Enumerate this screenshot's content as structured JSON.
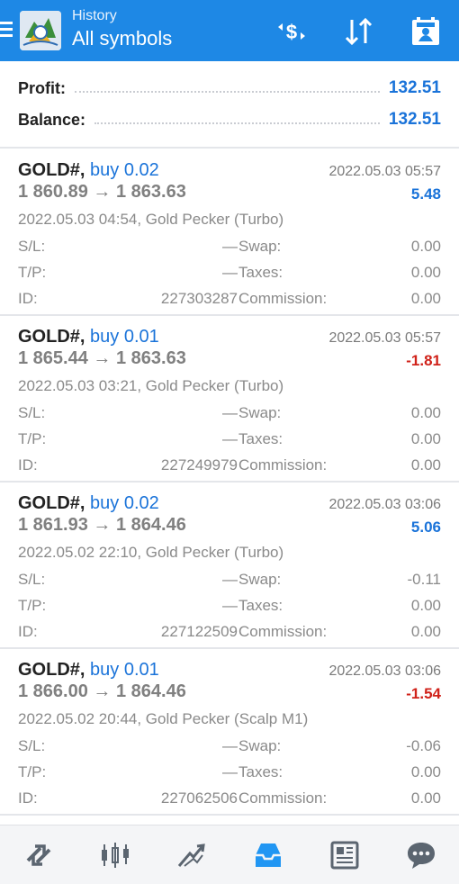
{
  "header": {
    "subtitle": "History",
    "title": "All symbols",
    "accent_color": "#1e88e5",
    "icons": [
      "menu-icon",
      "app-logo-icon",
      "currency-filter-icon",
      "sort-icon",
      "calendar-icon"
    ]
  },
  "summary": {
    "profit_label": "Profit:",
    "profit_value": "132.51",
    "balance_label": "Balance:",
    "balance_value": "132.51"
  },
  "trades": [
    {
      "symbol": "GOLD#,",
      "direction": "buy 0.02",
      "close_time": "2022.05.03 05:57",
      "prices": "1 860.89 → 1 863.63",
      "profit": "5.48",
      "profit_sign": "positive",
      "open_info": "2022.05.03 04:54, Gold Pecker (Turbo)",
      "sl_label": "S/L:",
      "sl_value": "—",
      "swap_label": "Swap:",
      "swap_value": "0.00",
      "tp_label": "T/P:",
      "tp_value": "—",
      "taxes_label": "Taxes:",
      "taxes_value": "0.00",
      "id_label": "ID:",
      "id_value": "227303287",
      "commission_label": "Commission:",
      "commission_value": "0.00"
    },
    {
      "symbol": "GOLD#,",
      "direction": "buy 0.01",
      "close_time": "2022.05.03 05:57",
      "prices": "1 865.44 → 1 863.63",
      "profit": "-1.81",
      "profit_sign": "negative",
      "open_info": "2022.05.03 03:21, Gold Pecker (Turbo)",
      "sl_label": "S/L:",
      "sl_value": "—",
      "swap_label": "Swap:",
      "swap_value": "0.00",
      "tp_label": "T/P:",
      "tp_value": "—",
      "taxes_label": "Taxes:",
      "taxes_value": "0.00",
      "id_label": "ID:",
      "id_value": "227249979",
      "commission_label": "Commission:",
      "commission_value": "0.00"
    },
    {
      "symbol": "GOLD#,",
      "direction": "buy 0.02",
      "close_time": "2022.05.03 03:06",
      "prices": "1 861.93 → 1 864.46",
      "profit": "5.06",
      "profit_sign": "positive",
      "open_info": "2022.05.02 22:10, Gold Pecker (Turbo)",
      "sl_label": "S/L:",
      "sl_value": "—",
      "swap_label": "Swap:",
      "swap_value": "-0.11",
      "tp_label": "T/P:",
      "tp_value": "—",
      "taxes_label": "Taxes:",
      "taxes_value": "0.00",
      "id_label": "ID:",
      "id_value": "227122509",
      "commission_label": "Commission:",
      "commission_value": "0.00"
    },
    {
      "symbol": "GOLD#,",
      "direction": "buy 0.01",
      "close_time": "2022.05.03 03:06",
      "prices": "1 866.00 → 1 864.46",
      "profit": "-1.54",
      "profit_sign": "negative",
      "open_info": "2022.05.02 20:44, Gold Pecker (Scalp M1)",
      "sl_label": "S/L:",
      "sl_value": "—",
      "swap_label": "Swap:",
      "swap_value": "-0.06",
      "tp_label": "T/P:",
      "tp_value": "—",
      "taxes_label": "Taxes:",
      "taxes_value": "0.00",
      "id_label": "ID:",
      "id_value": "227062506",
      "commission_label": "Commission:",
      "commission_value": "0.00"
    }
  ],
  "bottom_nav": {
    "items": [
      "quotes-icon",
      "chart-icon",
      "trade-icon",
      "history-icon",
      "news-icon",
      "chat-icon"
    ],
    "active": "history-icon"
  }
}
